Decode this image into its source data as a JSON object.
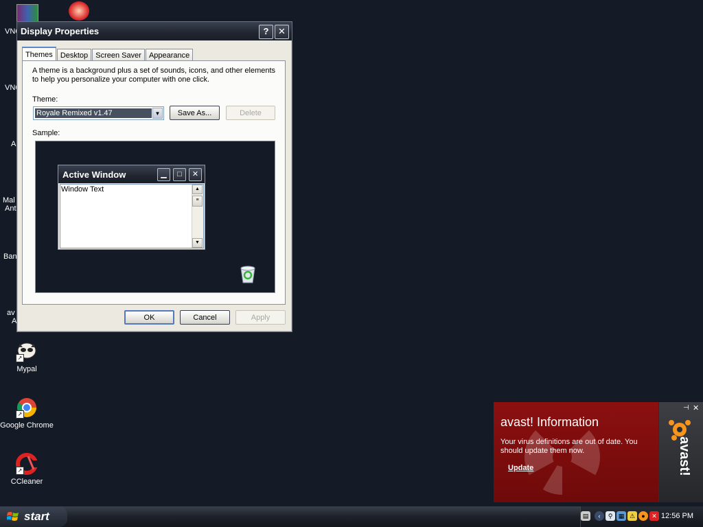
{
  "desktop": {
    "icons": [
      {
        "label": "Mypal"
      },
      {
        "label": "Google Chrome"
      },
      {
        "label": "CCleaner"
      }
    ],
    "partial_labels": [
      "VNC",
      "VNC",
      "A",
      "Mal",
      "Ant",
      "Ban",
      "av",
      "A"
    ]
  },
  "dialog": {
    "title": "Display Properties",
    "help_glyph": "?",
    "close_glyph": "✕",
    "tabs": [
      "Themes",
      "Desktop",
      "Screen Saver",
      "Appearance"
    ],
    "description": "A theme is a background plus a set of sounds, icons, and other elements to help you personalize your computer with one click.",
    "theme_label": "Theme:",
    "theme_value": "Royale Remixed v1.47",
    "save_as_label": "Save As...",
    "delete_label": "Delete",
    "sample_label": "Sample:",
    "sample_window": {
      "title": "Active Window",
      "text": "Window Text"
    },
    "ok_label": "OK",
    "cancel_label": "Cancel",
    "apply_label": "Apply"
  },
  "avast": {
    "heading": "avast! Information",
    "message": "Your virus definitions are out of date. You should update them now.",
    "update_link": "Update",
    "brand": "avast!"
  },
  "taskbar": {
    "start_label": "start",
    "clock": "12:56 PM"
  }
}
